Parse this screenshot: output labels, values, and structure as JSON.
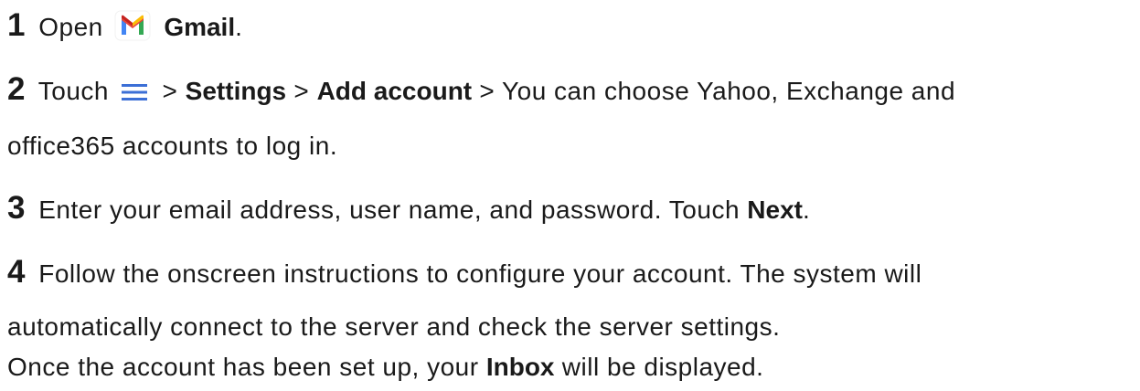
{
  "steps": [
    {
      "number": "1",
      "text_open": "Open",
      "app_name": "Gmail",
      "end": "."
    },
    {
      "number": "2",
      "text_touch": "Touch",
      "sep1": ">",
      "settings": "Settings",
      "sep2": ">",
      "add_account": "Add account",
      "rest_line1": "> You can choose Yahoo, Exchange and",
      "rest_line2": "office365 accounts to log in."
    },
    {
      "number": "3",
      "text": "Enter your email address, user name, and password. Touch",
      "next": "Next",
      "end": "."
    },
    {
      "number": "4",
      "line1": "Follow the onscreen instructions to configure your account. The system will",
      "line2": "automatically connect to the server and check the server settings.",
      "line3_start": "Once the account has been set up, your",
      "inbox": "Inbox",
      "line3_end": "will be displayed."
    }
  ],
  "icons": {
    "gmail": "gmail-icon",
    "menu": "menu-icon"
  },
  "colors": {
    "text": "#1a1a1a",
    "gmail_red": "#EA4335",
    "gmail_blue": "#4285F4",
    "gmail_green": "#34A853",
    "gmail_yellow": "#FBBC04",
    "gmail_darkred": "#C5221F",
    "menu_blue": "#3c6fd6"
  }
}
